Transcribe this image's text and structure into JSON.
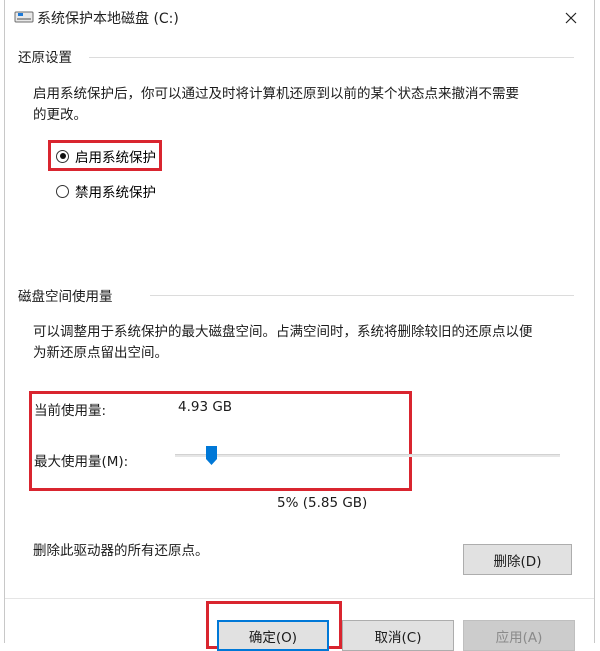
{
  "window": {
    "title": "系统保护本地磁盘 (C:)"
  },
  "restore_settings": {
    "group_label": "还原设置",
    "description_line1": "启用系统保护后，你可以通过及时将计算机还原到以前的某个状态点来撤消不需要",
    "description_line2": "的更改。",
    "options": [
      {
        "label": "启用系统保护",
        "checked": true
      },
      {
        "label": "禁用系统保护",
        "checked": false
      }
    ]
  },
  "disk_usage": {
    "group_label": "磁盘空间使用量",
    "description_line1": "可以调整用于系统保护的最大磁盘空间。占满空间时，系统将删除较旧的还原点以便",
    "description_line2": "为新还原点留出空间。",
    "current_label": "当前使用量:",
    "current_value": "4.93 GB",
    "max_label": "最大使用量(M):",
    "slider_fraction": 0.05,
    "slider_readout": "5% (5.85 GB)"
  },
  "delete": {
    "text": "删除此驱动器的所有还原点。",
    "button_label": "删除(D)"
  },
  "buttons": {
    "ok": "确定(O)",
    "cancel": "取消(C)",
    "apply": "应用(A)"
  },
  "colors": {
    "highlight_box": "#d9252f",
    "slider_thumb": "#0078d7",
    "default_button_border": "#0078d7"
  }
}
